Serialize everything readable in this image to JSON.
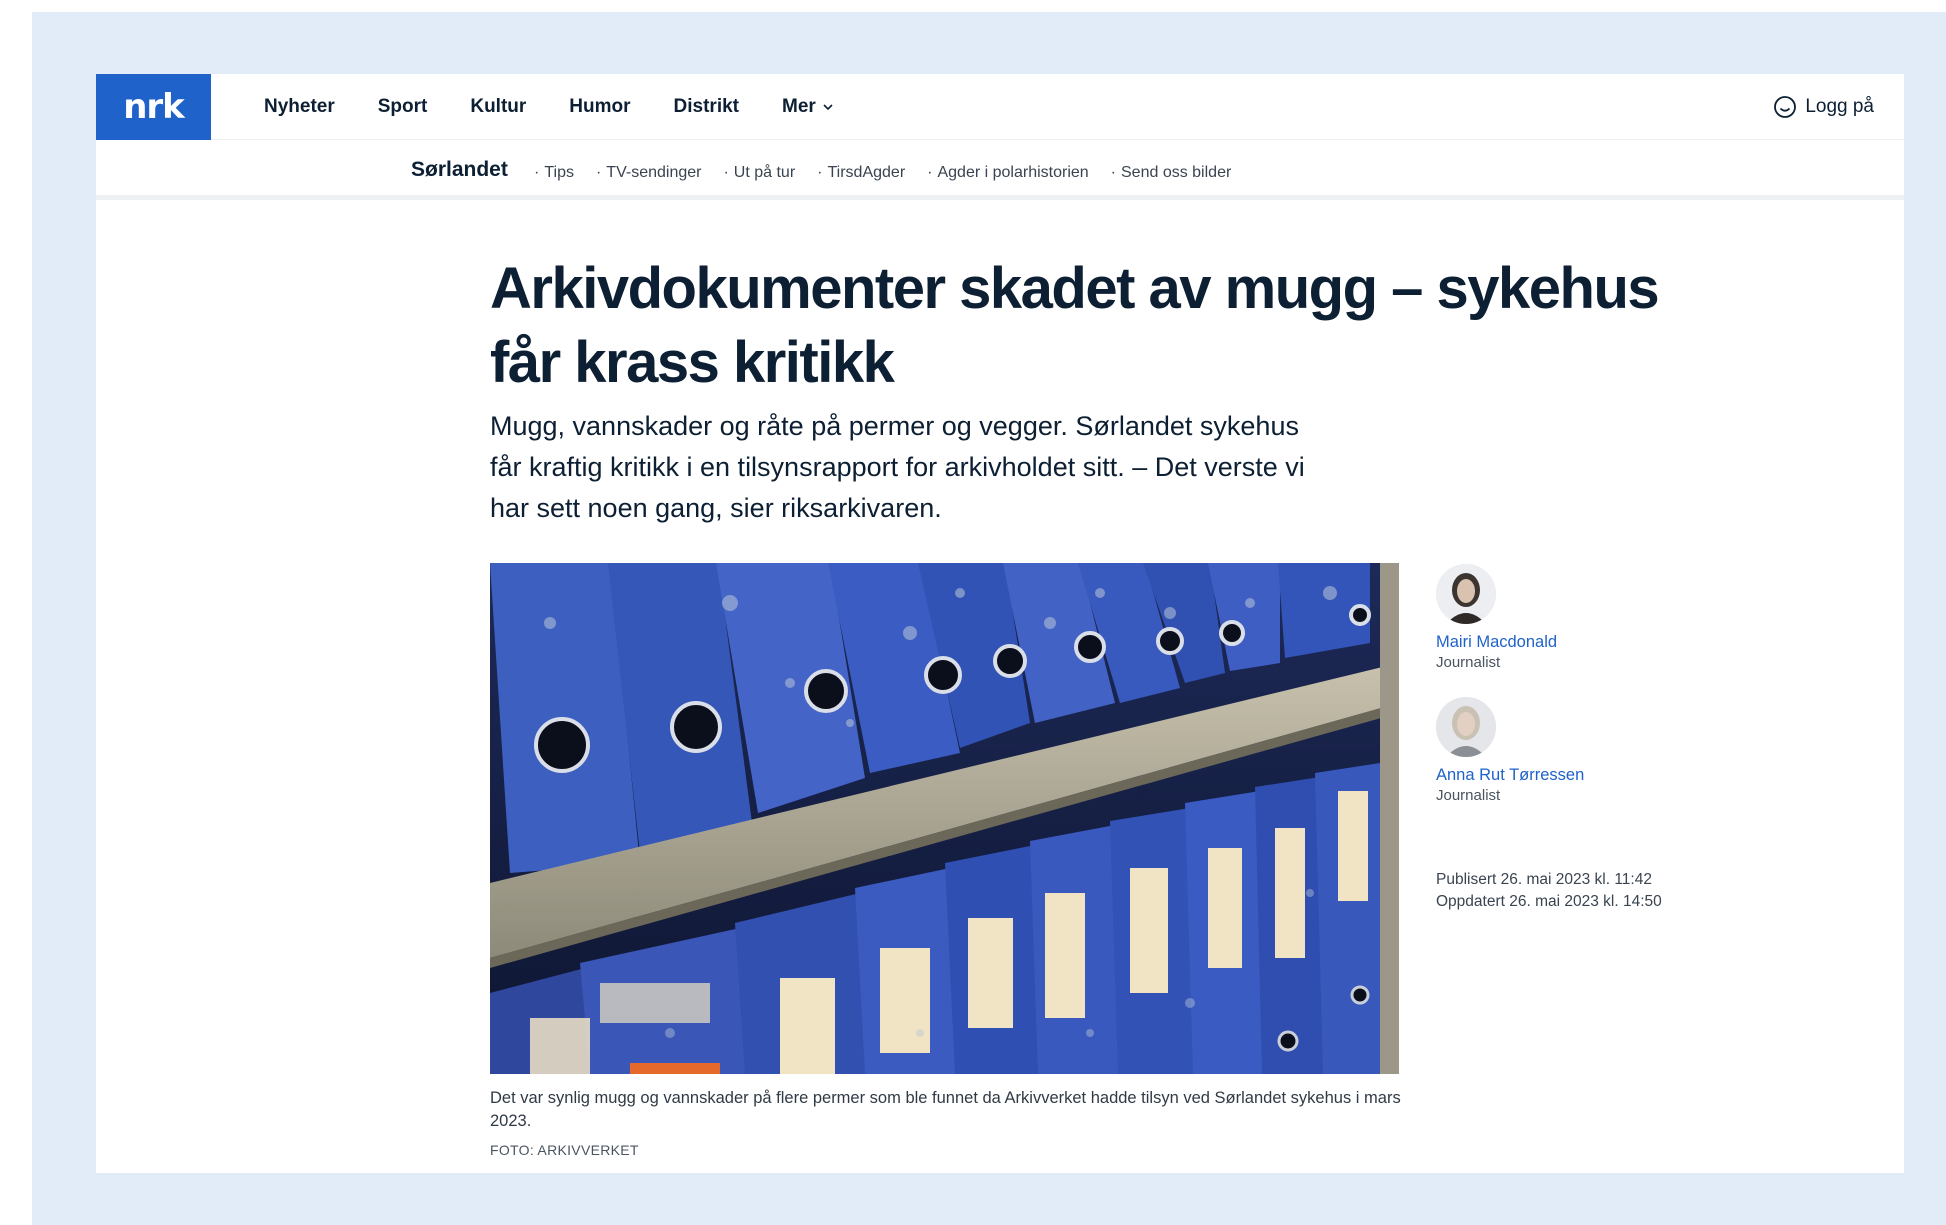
{
  "brand": {
    "logo_text": "nrk",
    "accent": "#1f62c9"
  },
  "nav": {
    "items": [
      "Nyheter",
      "Sport",
      "Kultur",
      "Humor",
      "Distrikt",
      "Mer"
    ],
    "login_label": "Logg på"
  },
  "subnav": {
    "region": "Sørlandet",
    "items": [
      "Tips",
      "TV-sendinger",
      "Ut på tur",
      "TirsdAgder",
      "Agder i polarhistorien",
      "Send oss bilder"
    ]
  },
  "article": {
    "headline": "Arkivdokumenter skadet av mugg – sykehus får krass kritikk",
    "lead": "Mugg, vannskader og råte på permer og vegger. Sørlandet sykehus får kraftig kritikk i en tilsynsrapport for arkivholdet sitt. – Det verste vi har sett noen gang, sier riksarkivaren.",
    "caption": "Det var synlig mugg og vannskader på flere permer som ble funnet da Arkivverket hadde tilsyn ved Sørlandet sykehus i mars 2023.",
    "photo_credit": "FOTO: ARKIVVERKET"
  },
  "authors": [
    {
      "name": "Mairi Macdonald",
      "role": "Journalist"
    },
    {
      "name": "Anna Rut Tørressen",
      "role": "Journalist"
    }
  ],
  "dates": {
    "published": "Publisert 26. mai 2023 kl. 11:42",
    "updated": "Oppdatert 26. mai 2023 kl. 14:50"
  }
}
